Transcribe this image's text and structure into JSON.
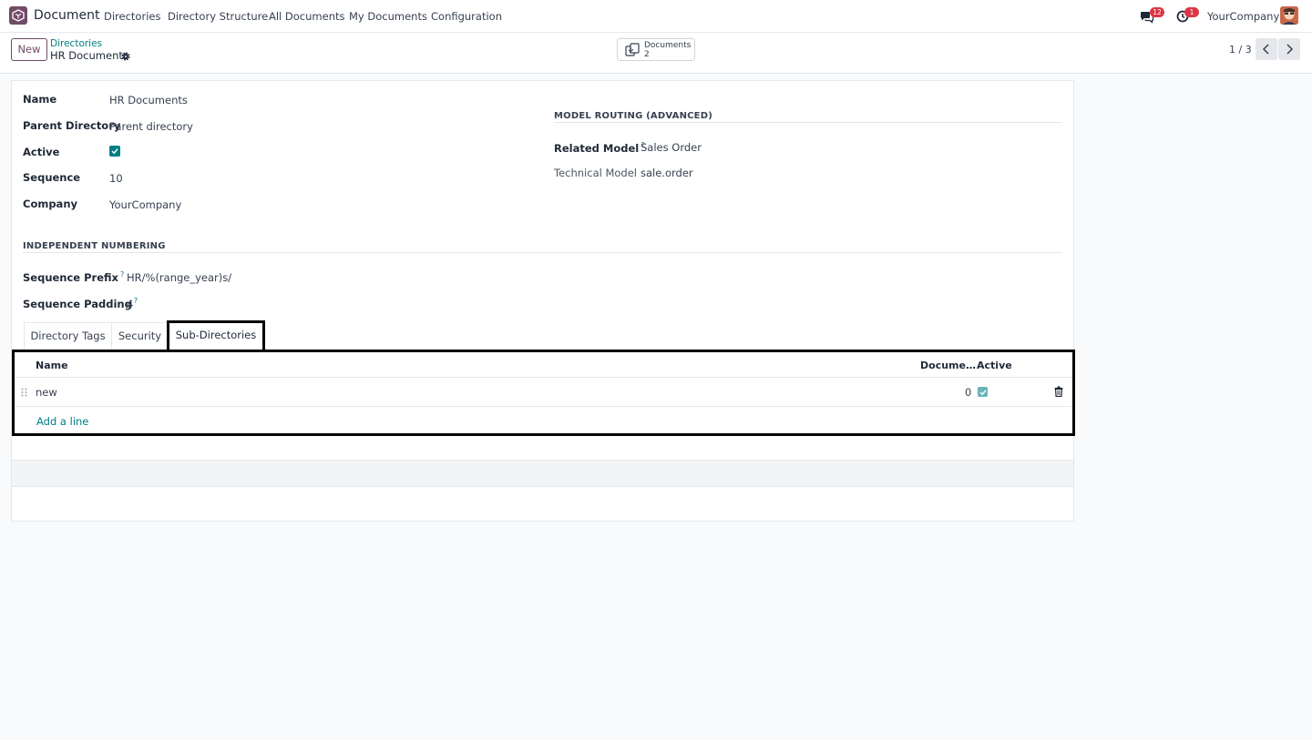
{
  "app": {
    "name": "Document"
  },
  "menu": [
    "Directories",
    "Directory Structure",
    "All Documents",
    "My Documents",
    "Configuration"
  ],
  "systray": {
    "messages_count": "12",
    "activities_count": "1",
    "company": "YourCompany"
  },
  "control": {
    "new_label": "New",
    "breadcrumb_parent": "Directories",
    "breadcrumb_current": "HR Documents",
    "smart_button": {
      "label": "Documents",
      "value": "2"
    },
    "pager": "1 / 3"
  },
  "form": {
    "left": [
      {
        "label": "Name",
        "value": "HR Documents"
      },
      {
        "label": "Parent Directory",
        "value": "Parent directory"
      },
      {
        "label": "Active",
        "value": ""
      },
      {
        "label": "Sequence",
        "value": "10"
      },
      {
        "label": "Company",
        "value": "YourCompany"
      }
    ],
    "routing": {
      "title": "MODEL ROUTING (ADVANCED)",
      "related_model_label": "Related Model",
      "related_model_value": "Sales Order",
      "technical_model_label": "Technical Model",
      "technical_model_value": "sale.order"
    },
    "numbering": {
      "title": "INDEPENDENT NUMBERING",
      "prefix_label": "Sequence Prefix",
      "prefix_value": "HR/%(range_year)s/",
      "padding_label": "Sequence Padding",
      "padding_value": "4"
    },
    "help_mark": "?"
  },
  "tabs": [
    "Directory Tags",
    "Security",
    "Sub-Directories"
  ],
  "active_tab": "Sub-Directories",
  "subdirs": {
    "columns": {
      "name": "Name",
      "documents": "Docume…",
      "active": "Active"
    },
    "rows": [
      {
        "name": "new",
        "documents": "0",
        "active": true
      }
    ],
    "add_line": "Add a line"
  },
  "colors": {
    "brand": "#714b67",
    "accent": "#017e84",
    "badge": "#dc3545"
  }
}
